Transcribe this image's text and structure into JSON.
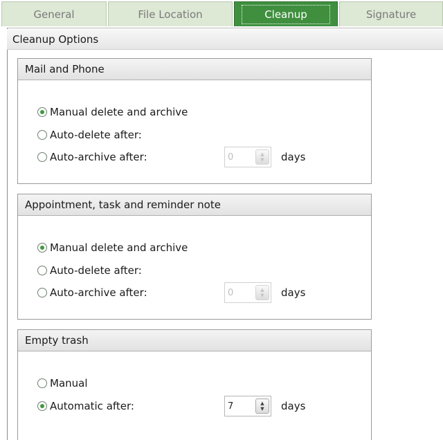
{
  "tabs": [
    {
      "label": "General"
    },
    {
      "label": "File Location"
    },
    {
      "label": "Cleanup"
    },
    {
      "label": "Signature"
    }
  ],
  "panel": {
    "title": "Cleanup Options"
  },
  "groups": [
    {
      "title": "Mail and Phone",
      "options": [
        {
          "label": "Manual delete and archive",
          "checked": true
        },
        {
          "label": "Auto-delete after:",
          "checked": false
        },
        {
          "label": "Auto-archive after:",
          "checked": false
        }
      ],
      "spinner_value": "0",
      "spinner_enabled": false,
      "unit": "days"
    },
    {
      "title": "Appointment, task and reminder note",
      "options": [
        {
          "label": "Manual delete and archive",
          "checked": true
        },
        {
          "label": "Auto-delete after:",
          "checked": false
        },
        {
          "label": "Auto-archive after:",
          "checked": false
        }
      ],
      "spinner_value": "0",
      "spinner_enabled": false,
      "unit": "days"
    },
    {
      "title": "Empty trash",
      "options": [
        {
          "label": "Manual",
          "checked": false
        },
        {
          "label": "Automatic after:",
          "checked": true
        }
      ],
      "spinner_value": "7",
      "spinner_enabled": true,
      "unit": "days"
    }
  ],
  "colors": {
    "active_tab": "#3f8f3f",
    "inactive_tab": "#dde8d5",
    "radio_dot": "#3f9a3f"
  },
  "icons": {
    "spinner_up": "spinner-up-arrow-icon",
    "spinner_down": "spinner-down-arrow-icon"
  }
}
